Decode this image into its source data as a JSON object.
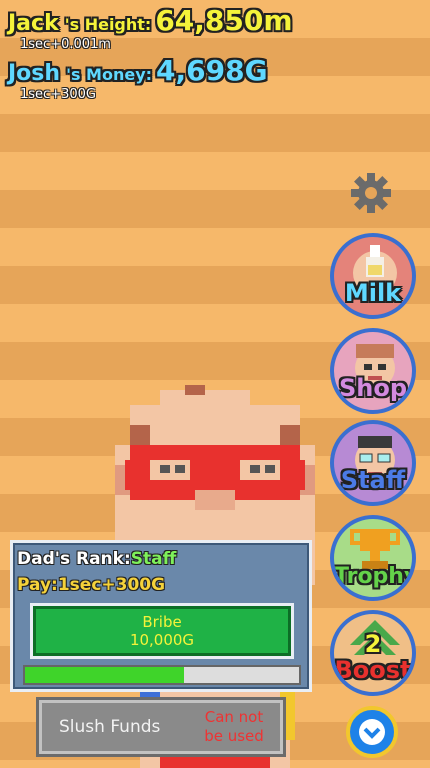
{
  "hud": {
    "height_name": "Jack",
    "height_suffix": "'s Height:",
    "height_value": "64,850m",
    "height_rate": "1sec+0.001m",
    "money_name": "Josh",
    "money_suffix": "'s Money:",
    "money_value": "4,698G",
    "money_rate": "1sec+300G"
  },
  "side_buttons": {
    "milk": "Milk",
    "shop": "Shop",
    "staff": "Staff",
    "trophy": "Trophy",
    "boost": "Boost",
    "boost_count": "2"
  },
  "rank_panel": {
    "rank_label": "Dad's Rank:",
    "rank_value": "Staff",
    "pay_label": "Pay:",
    "pay_value": "1sec+300G",
    "bribe_label": "Bribe",
    "bribe_cost": "10,000G",
    "progress_fraction": 0.58
  },
  "slush_funds": {
    "label": "Slush Funds",
    "status_line1": "Can not",
    "status_line2": "be used"
  },
  "icons": {
    "settings": "gear-icon",
    "menu_toggle": "chevron-down-icon"
  },
  "colors": {
    "height_text": "#f5f33a",
    "money_text": "#5fd8ff",
    "rank_value": "#7ef05a",
    "pay_text": "#f5d23a",
    "bribe_button": "#1fb246",
    "progress_fill": "#3fd42a",
    "status_red": "#e33333"
  }
}
